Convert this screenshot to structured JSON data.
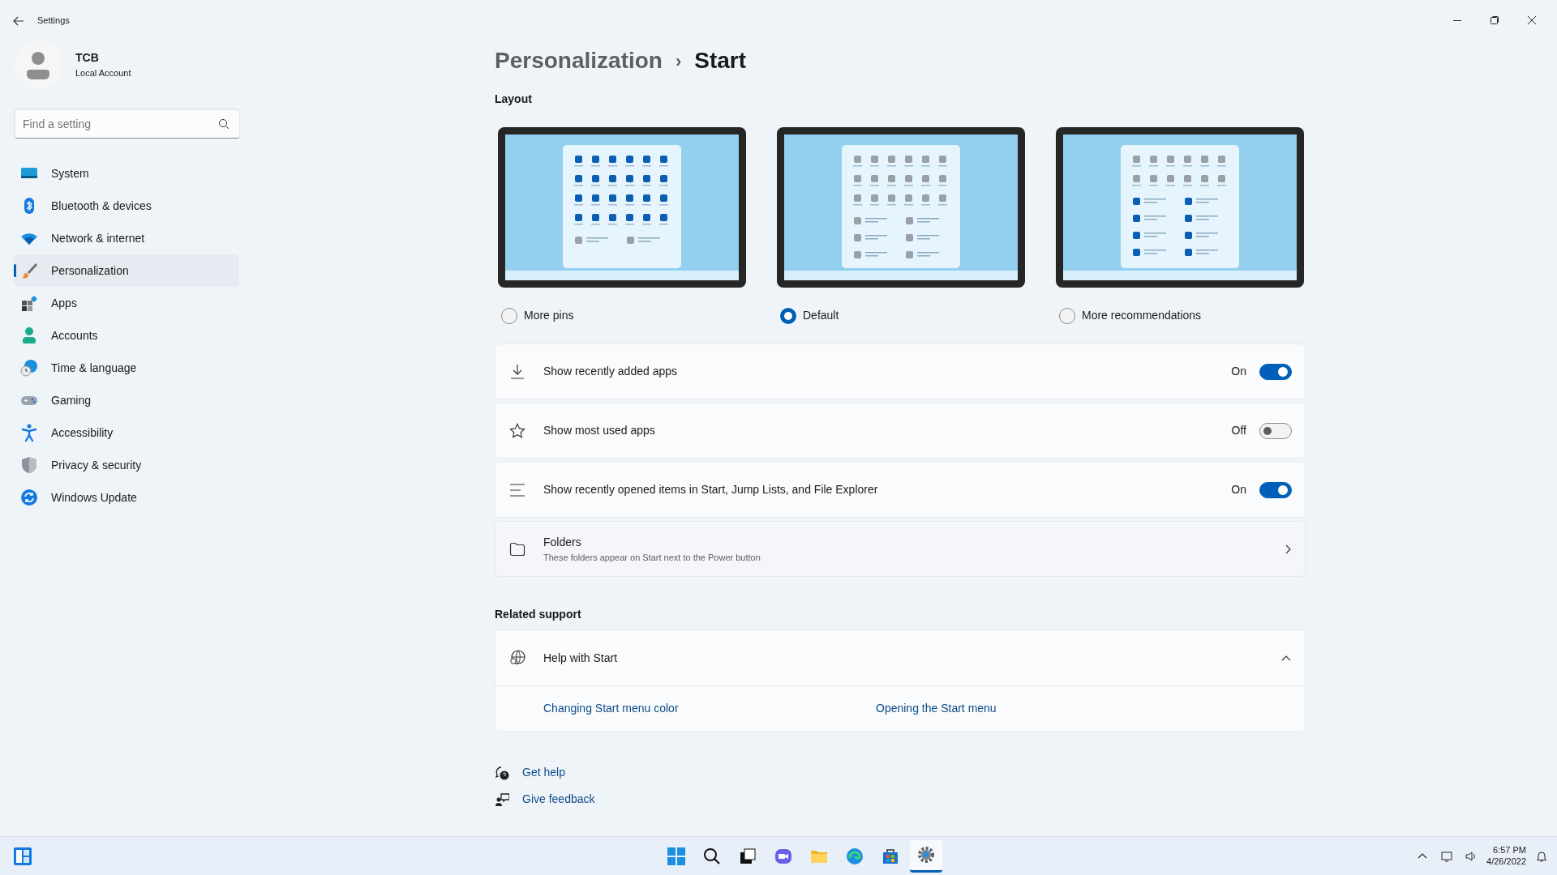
{
  "window": {
    "title": "Settings"
  },
  "account": {
    "name": "TCB",
    "type": "Local Account"
  },
  "search": {
    "placeholder": "Find a setting"
  },
  "sidebar": {
    "items": [
      {
        "label": "System",
        "selected": false
      },
      {
        "label": "Bluetooth & devices",
        "selected": false
      },
      {
        "label": "Network & internet",
        "selected": false
      },
      {
        "label": "Personalization",
        "selected": true
      },
      {
        "label": "Apps",
        "selected": false
      },
      {
        "label": "Accounts",
        "selected": false
      },
      {
        "label": "Time & language",
        "selected": false
      },
      {
        "label": "Gaming",
        "selected": false
      },
      {
        "label": "Accessibility",
        "selected": false
      },
      {
        "label": "Privacy & security",
        "selected": false
      },
      {
        "label": "Windows Update",
        "selected": false
      }
    ]
  },
  "breadcrumb": {
    "parent": "Personalization",
    "separator": "›",
    "current": "Start"
  },
  "layout": {
    "heading": "Layout",
    "options": [
      {
        "label": "More pins",
        "selected": false
      },
      {
        "label": "Default",
        "selected": true
      },
      {
        "label": "More recommendations",
        "selected": false
      }
    ]
  },
  "settings": [
    {
      "kind": "toggle",
      "label": "Show recently added apps",
      "state": "On",
      "on": true
    },
    {
      "kind": "toggle",
      "label": "Show most used apps",
      "state": "Off",
      "on": false
    },
    {
      "kind": "toggle",
      "label": "Show recently opened items in Start, Jump Lists, and File Explorer",
      "state": "On",
      "on": true
    },
    {
      "kind": "link",
      "label": "Folders",
      "description": "These folders appear on Start next to the Power button"
    }
  ],
  "related_support": {
    "heading": "Related support",
    "title": "Help with Start",
    "expanded": true,
    "links": [
      "Changing Start menu color",
      "Opening the Start menu"
    ]
  },
  "footer_links": [
    "Get help",
    "Give feedback"
  ],
  "taskbar": {
    "time": "6:57 PM",
    "date": "4/26/2022"
  }
}
